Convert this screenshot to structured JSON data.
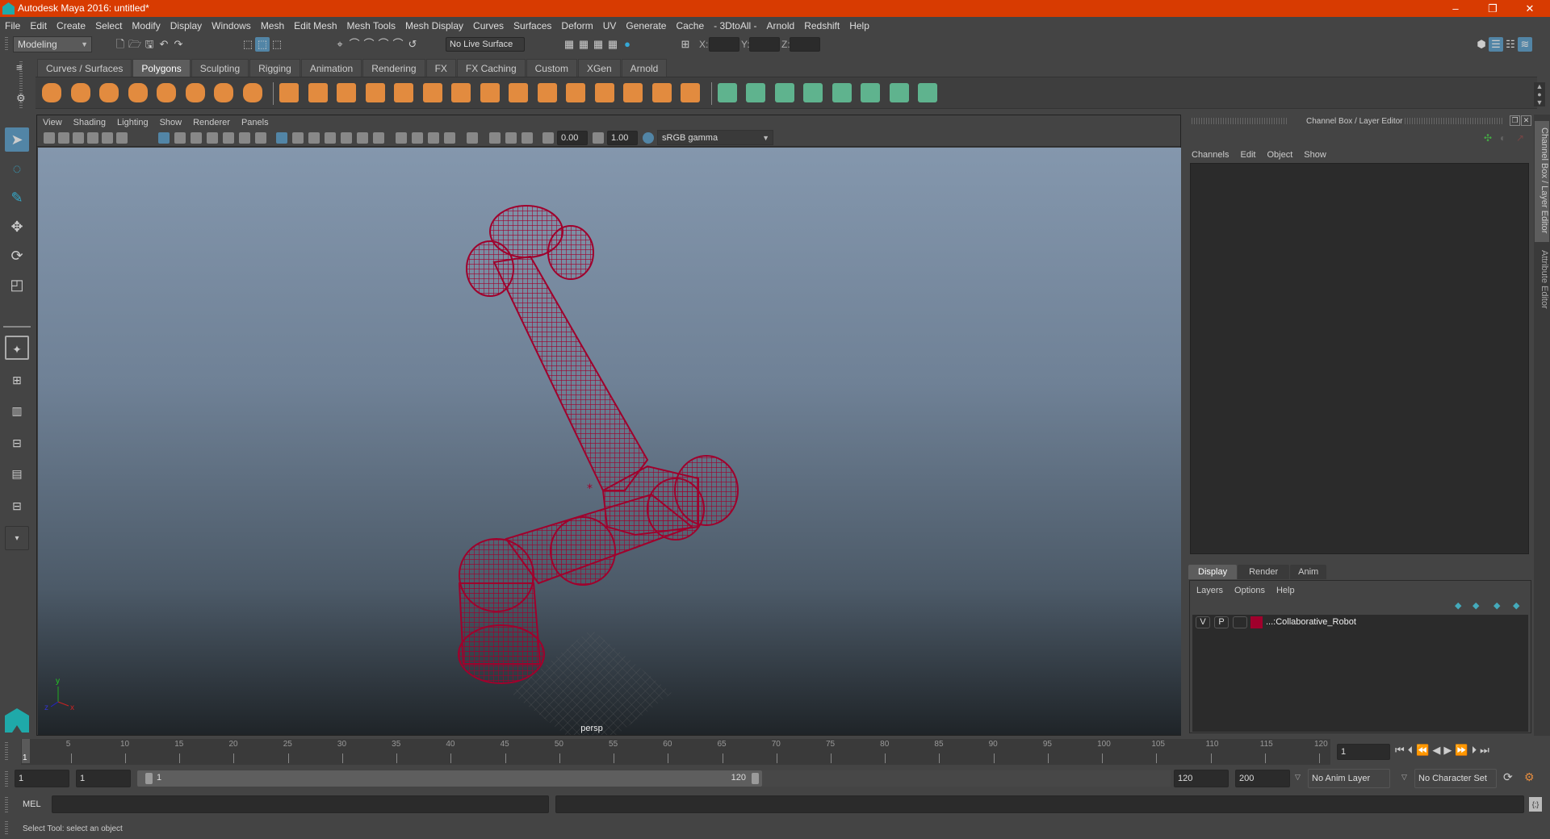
{
  "window": {
    "title": "Autodesk Maya 2016: untitled*",
    "controls": {
      "minimize": "–",
      "restore": "❐",
      "close": "✕"
    }
  },
  "menubar": [
    "File",
    "Edit",
    "Create",
    "Select",
    "Modify",
    "Display",
    "Windows",
    "Mesh",
    "Edit Mesh",
    "Mesh Tools",
    "Mesh Display",
    "Curves",
    "Surfaces",
    "Deform",
    "UV",
    "Generate",
    "Cache",
    "- 3DtoAll -",
    "Arnold",
    "Redshift",
    "Help"
  ],
  "statusline": {
    "menuset": "Modeling",
    "live_surface": "No Live Surface",
    "x_label": "X:",
    "y_label": "Y:",
    "z_label": "Z:",
    "x_value": "",
    "y_value": "",
    "z_value": ""
  },
  "shelf": {
    "tabs": [
      "Curves / Surfaces",
      "Polygons",
      "Sculpting",
      "Rigging",
      "Animation",
      "Rendering",
      "FX",
      "FX Caching",
      "Custom",
      "XGen",
      "Arnold"
    ],
    "active_tab": "Polygons",
    "icons": [
      "poly-sphere",
      "poly-cube",
      "poly-cylinder",
      "poly-cone",
      "poly-plane",
      "poly-torus",
      "poly-pyramid",
      "poly-pipe",
      "combine",
      "separate",
      "mirror",
      "smooth",
      "extract",
      "bevel",
      "bridge",
      "extrude",
      "multi-cut",
      "target-weld",
      "merge",
      "append",
      "poly-extrude-face",
      "split",
      "insert-edge-loop",
      "offset-edge-loop",
      "planar-map",
      "cylindrical-map",
      "spherical-map",
      "automatic-map",
      "unfold",
      "uv-editor",
      "layout-uv"
    ]
  },
  "viewport": {
    "menu": [
      "View",
      "Shading",
      "Lighting",
      "Show",
      "Renderer",
      "Panels"
    ],
    "exposure": "0.00",
    "gamma": "1.00",
    "color_space": "sRGB gamma",
    "camera_label": "persp",
    "axis": {
      "x": "x",
      "y": "y",
      "z": "z"
    },
    "wire_color": "#a0002c",
    "object_name": "Collaborative_Robot"
  },
  "channel_box": {
    "title": "Channel Box / Layer Editor",
    "menu": [
      "Channels",
      "Edit",
      "Object",
      "Show"
    ]
  },
  "layer_editor": {
    "tabs": [
      "Display",
      "Render",
      "Anim"
    ],
    "active_tab": "Display",
    "menu": [
      "Layers",
      "Options",
      "Help"
    ],
    "layers": [
      {
        "visible": "V",
        "playback": "P",
        "type": "",
        "color": "#a0002c",
        "name": "...:Collaborative_Robot"
      }
    ]
  },
  "side_tabs": [
    "Channel Box / Layer Editor",
    "Attribute Editor"
  ],
  "timeline": {
    "ticks": [
      "5",
      "10",
      "15",
      "20",
      "25",
      "30",
      "35",
      "40",
      "45",
      "50",
      "55",
      "60",
      "65",
      "70",
      "75",
      "80",
      "85",
      "90",
      "95",
      "100",
      "105",
      "110",
      "115",
      "120"
    ],
    "current_frame_marker": "1",
    "current_frame": "1",
    "start": 1,
    "end": 120
  },
  "range": {
    "start_time": "1",
    "playback_start": "1",
    "slider_start": "1",
    "slider_end": "120",
    "playback_end": "120",
    "end_time": "200",
    "anim_layer": "No Anim Layer",
    "character_set": "No Character Set"
  },
  "command_line": {
    "label": "MEL",
    "value": "",
    "result": ""
  },
  "help_line": "Select Tool: select an object"
}
